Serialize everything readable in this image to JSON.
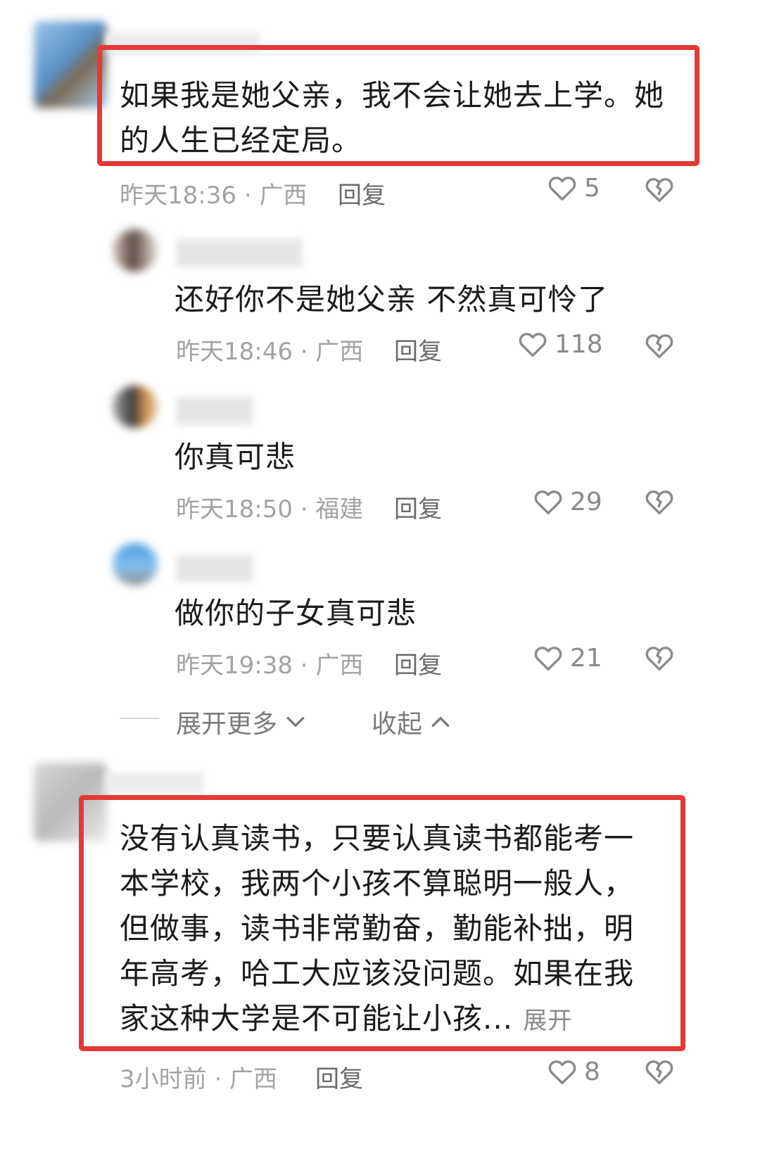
{
  "comments": [
    {
      "text": "如果我是她父亲，我不会让她去上学。她的人生已经定局。",
      "time": "昨天18:36 · 广西",
      "reply": "回复",
      "likes": "5"
    },
    {
      "text": "没有认真读书，只要认真读书都能考一本学校，我两个小孩不算聪明一般人，但做事，读书非常勤奋，勤能补拙，明年高考，哈工大应该没问题。如果在我家这种大学是不可能让小孩...",
      "expand": "展开",
      "time": "3小时前 · 广西",
      "reply": "回复",
      "likes": "8"
    }
  ],
  "replies": [
    {
      "text": "还好你不是她父亲 不然真可怜了",
      "time": "昨天18:46 · 广西",
      "reply": "回复",
      "likes": "118"
    },
    {
      "text": "你真可悲",
      "time": "昨天18:50 · 福建",
      "reply": "回复",
      "likes": "29"
    },
    {
      "text": "做你的子女真可悲",
      "time": "昨天19:38 · 广西",
      "reply": "回复",
      "likes": "21"
    }
  ],
  "thread_controls": {
    "expand_more": "展开更多",
    "collapse": "收起"
  },
  "colors": {
    "highlight_box": "#e53935",
    "meta_text": "#a3a3a3"
  },
  "icons": [
    "heart-outline-icon",
    "dislike-broken-heart-icon",
    "chevron-down-icon",
    "chevron-up-icon"
  ]
}
